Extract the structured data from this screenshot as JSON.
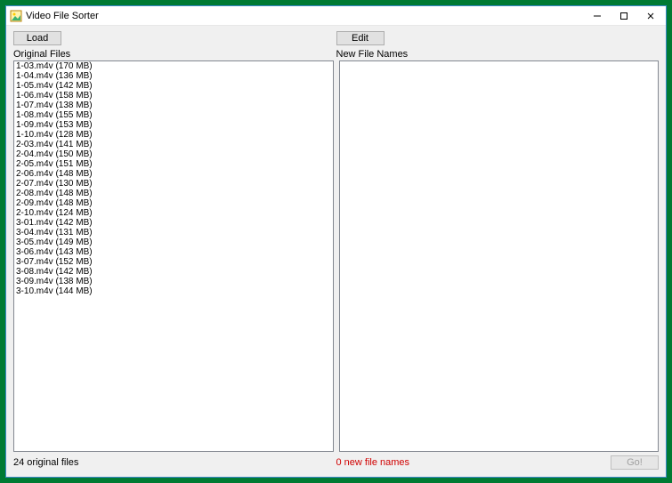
{
  "title": "Video File Sorter",
  "toolbar": {
    "load_label": "Load",
    "edit_label": "Edit"
  },
  "labels": {
    "left": "Original Files",
    "right": "New File Names"
  },
  "original_files": [
    "1-03.m4v (170 MB)",
    "1-04.m4v (136 MB)",
    "1-05.m4v (142 MB)",
    "1-06.m4v (158 MB)",
    "1-07.m4v (138 MB)",
    "1-08.m4v (155 MB)",
    "1-09.m4v (153 MB)",
    "1-10.m4v (128 MB)",
    "2-03.m4v (141 MB)",
    "2-04.m4v (150 MB)",
    "2-05.m4v (151 MB)",
    "2-06.m4v (148 MB)",
    "2-07.m4v (130 MB)",
    "2-08.m4v (148 MB)",
    "2-09.m4v (148 MB)",
    "2-10.m4v (124 MB)",
    "3-01.m4v (142 MB)",
    "3-04.m4v (131 MB)",
    "3-05.m4v (149 MB)",
    "3-06.m4v (143 MB)",
    "3-07.m4v (152 MB)",
    "3-08.m4v (142 MB)",
    "3-09.m4v (138 MB)",
    "3-10.m4v (144 MB)"
  ],
  "status": {
    "left": "24 original files",
    "right": "0 new file names"
  },
  "go_label": "Go!"
}
